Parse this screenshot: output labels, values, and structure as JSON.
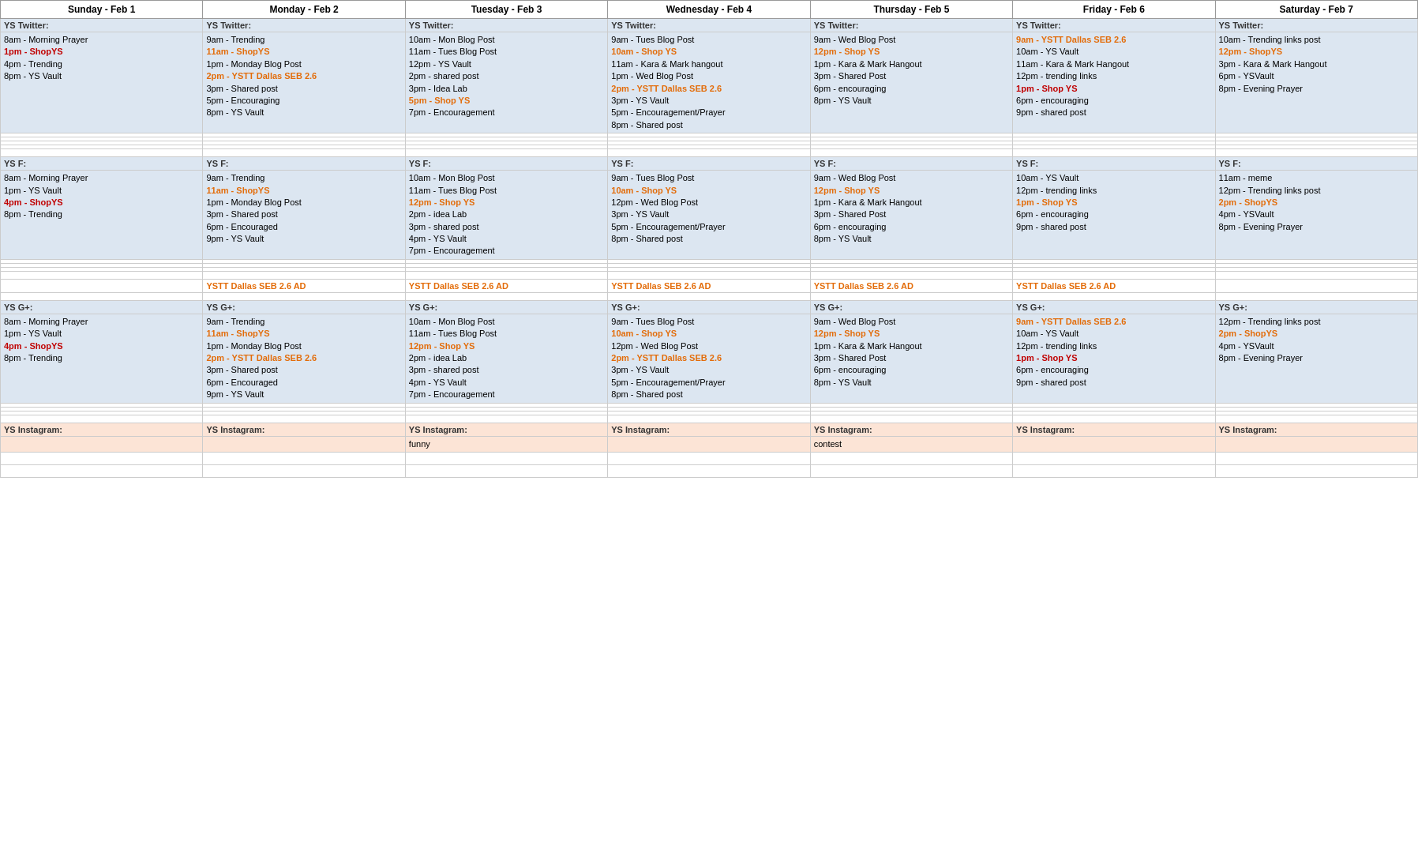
{
  "headers": [
    "Sunday - Feb 1",
    "Monday - Feb 2",
    "Tuesday - Feb 3",
    "Wednesday - Feb 4",
    "Thursday - Feb 5",
    "Friday - Feb 6",
    "Saturday - Feb 7"
  ],
  "twitter_section": {
    "label": "YS Twitter:",
    "bg": "bg-blue",
    "rows": [
      {
        "sun": [
          {
            "text": "8am - Morning Prayer",
            "color": "black"
          },
          {
            "text": "1pm - ShopYS",
            "color": "red"
          },
          {
            "text": "4pm - Trending",
            "color": "black"
          },
          {
            "text": "8pm - YS Vault",
            "color": "black"
          }
        ],
        "mon": [
          {
            "text": "9am - Trending",
            "color": "black"
          },
          {
            "text": "11am - ShopYS",
            "color": "orange"
          },
          {
            "text": "1pm - Monday Blog Post",
            "color": "black"
          },
          {
            "text": "2pm - YSTT Dallas SEB 2.6",
            "color": "orange"
          },
          {
            "text": "3pm - Shared post",
            "color": "black"
          },
          {
            "text": "5pm - Encouraging",
            "color": "black"
          },
          {
            "text": "8pm - YS Vault",
            "color": "black"
          }
        ],
        "tue": [
          {
            "text": "10am - Mon Blog Post",
            "color": "black"
          },
          {
            "text": "11am - Tues Blog Post",
            "color": "black"
          },
          {
            "text": "12pm - YS Vault",
            "color": "black"
          },
          {
            "text": "2pm - shared post",
            "color": "black"
          },
          {
            "text": "3pm - Idea Lab",
            "color": "black"
          },
          {
            "text": "5pm - Shop YS",
            "color": "orange"
          },
          {
            "text": "7pm - Encouragement",
            "color": "black"
          }
        ],
        "wed": [
          {
            "text": "9am - Tues Blog Post",
            "color": "black"
          },
          {
            "text": "10am - Shop YS",
            "color": "orange"
          },
          {
            "text": "11am - Kara & Mark hangout",
            "color": "black"
          },
          {
            "text": "1pm - Wed Blog Post",
            "color": "black"
          },
          {
            "text": "2pm - YSTT Dallas SEB 2.6",
            "color": "orange"
          },
          {
            "text": "3pm - YS Vault",
            "color": "black"
          },
          {
            "text": "5pm - Encouragement/Prayer",
            "color": "black"
          },
          {
            "text": "8pm - Shared post",
            "color": "black"
          }
        ],
        "thu": [
          {
            "text": "9am - Wed Blog Post",
            "color": "black"
          },
          {
            "text": "12pm - Shop YS",
            "color": "orange"
          },
          {
            "text": "1pm - Kara & Mark Hangout",
            "color": "black"
          },
          {
            "text": "3pm - Shared Post",
            "color": "black"
          },
          {
            "text": "6pm - encouraging",
            "color": "black"
          },
          {
            "text": "8pm - YS Vault",
            "color": "black"
          }
        ],
        "fri": [
          {
            "text": "9am - YSTT Dallas SEB 2.6",
            "color": "orange"
          },
          {
            "text": "10am - YS Vault",
            "color": "black"
          },
          {
            "text": "11am - Kara & Mark Hangout",
            "color": "black"
          },
          {
            "text": "12pm - trending links",
            "color": "black"
          },
          {
            "text": "1pm - Shop YS",
            "color": "red"
          },
          {
            "text": "6pm - encouraging",
            "color": "black"
          },
          {
            "text": "9pm - shared post",
            "color": "black"
          }
        ],
        "sat": [
          {
            "text": "10am - Trending links post",
            "color": "black"
          },
          {
            "text": "12pm - ShopYS",
            "color": "orange"
          },
          {
            "text": "3pm - Kara & Mark Hangout",
            "color": "black"
          },
          {
            "text": "6pm - YSVault",
            "color": "black"
          },
          {
            "text": "8pm - Evening Prayer",
            "color": "black"
          }
        ]
      }
    ]
  },
  "facebook_section": {
    "label": "YS F:",
    "bg": "bg-blue",
    "rows": [
      {
        "sun": [
          {
            "text": "8am - Morning Prayer",
            "color": "black"
          },
          {
            "text": "1pm - YS Vault",
            "color": "black"
          },
          {
            "text": "4pm - ShopYS",
            "color": "red"
          },
          {
            "text": "8pm - Trending",
            "color": "black"
          }
        ],
        "mon": [
          {
            "text": "9am - Trending",
            "color": "black"
          },
          {
            "text": "11am - ShopYS",
            "color": "orange"
          },
          {
            "text": "1pm - Monday Blog Post",
            "color": "black"
          },
          {
            "text": "3pm - Shared post",
            "color": "black"
          },
          {
            "text": "6pm - Encouraged",
            "color": "black"
          },
          {
            "text": "9pm - YS Vault",
            "color": "black"
          }
        ],
        "tue": [
          {
            "text": "10am - Mon Blog Post",
            "color": "black"
          },
          {
            "text": "11am - Tues Blog Post",
            "color": "black"
          },
          {
            "text": "12pm - Shop YS",
            "color": "orange"
          },
          {
            "text": "2pm - idea Lab",
            "color": "black"
          },
          {
            "text": "3pm - shared post",
            "color": "black"
          },
          {
            "text": "4pm - YS Vault",
            "color": "black"
          },
          {
            "text": "7pm - Encouragement",
            "color": "black"
          }
        ],
        "wed": [
          {
            "text": "9am - Tues Blog Post",
            "color": "black"
          },
          {
            "text": "10am - Shop YS",
            "color": "orange"
          },
          {
            "text": "12pm - Wed Blog Post",
            "color": "black"
          },
          {
            "text": "3pm - YS Vault",
            "color": "black"
          },
          {
            "text": "5pm - Encouragement/Prayer",
            "color": "black"
          },
          {
            "text": "8pm - Shared post",
            "color": "black"
          }
        ],
        "thu": [
          {
            "text": "9am - Wed Blog Post",
            "color": "black"
          },
          {
            "text": "12pm - Shop YS",
            "color": "orange"
          },
          {
            "text": "1pm - Kara & Mark Hangout",
            "color": "black"
          },
          {
            "text": "3pm - Shared Post",
            "color": "black"
          },
          {
            "text": "6pm - encouraging",
            "color": "black"
          },
          {
            "text": "8pm - YS Vault",
            "color": "black"
          }
        ],
        "fri": [
          {
            "text": "10am - YS Vault",
            "color": "black"
          },
          {
            "text": "12pm - trending links",
            "color": "black"
          },
          {
            "text": "1pm - Shop YS",
            "color": "orange"
          },
          {
            "text": "6pm - encouraging",
            "color": "black"
          },
          {
            "text": "9pm - shared post",
            "color": "black"
          }
        ],
        "sat": [
          {
            "text": "11am - meme",
            "color": "black"
          },
          {
            "text": "12pm - Trending links post",
            "color": "black"
          },
          {
            "text": "2pm - ShopYS",
            "color": "orange"
          },
          {
            "text": "4pm - YSVault",
            "color": "black"
          },
          {
            "text": "8pm - Evening Prayer",
            "color": "black"
          }
        ]
      }
    ]
  },
  "ystt_row": {
    "sun": "",
    "mon": "YSTT Dallas SEB 2.6 AD",
    "tue": "YSTT Dallas SEB 2.6 AD",
    "wed": "YSTT Dallas SEB 2.6 AD",
    "thu": "YSTT Dallas SEB 2.6 AD",
    "fri": "YSTT Dallas SEB 2.6 AD",
    "sat": ""
  },
  "gplus_section": {
    "label": "YS G+:",
    "bg": "bg-blue",
    "rows": [
      {
        "sun": [
          {
            "text": "8am - Morning Prayer",
            "color": "black"
          },
          {
            "text": "1pm - YS Vault",
            "color": "black"
          },
          {
            "text": "4pm - ShopYS",
            "color": "red"
          },
          {
            "text": "8pm - Trending",
            "color": "black"
          }
        ],
        "mon": [
          {
            "text": "9am - Trending",
            "color": "black"
          },
          {
            "text": "11am - ShopYS",
            "color": "orange"
          },
          {
            "text": "1pm - Monday Blog Post",
            "color": "black"
          },
          {
            "text": "2pm - YSTT Dallas SEB 2.6",
            "color": "orange"
          },
          {
            "text": "3pm - Shared post",
            "color": "black"
          },
          {
            "text": "6pm - Encouraged",
            "color": "black"
          },
          {
            "text": "9pm - YS Vault",
            "color": "black"
          }
        ],
        "tue": [
          {
            "text": "10am - Mon Blog Post",
            "color": "black"
          },
          {
            "text": "11am - Tues Blog Post",
            "color": "black"
          },
          {
            "text": "12pm - Shop YS",
            "color": "orange"
          },
          {
            "text": "2pm - idea Lab",
            "color": "black"
          },
          {
            "text": "3pm - shared post",
            "color": "black"
          },
          {
            "text": "4pm - YS Vault",
            "color": "black"
          },
          {
            "text": "7pm - Encouragement",
            "color": "black"
          }
        ],
        "wed": [
          {
            "text": "9am - Tues Blog Post",
            "color": "black"
          },
          {
            "text": "10am - Shop YS",
            "color": "orange"
          },
          {
            "text": "12pm - Wed Blog Post",
            "color": "black"
          },
          {
            "text": "2pm - YSTT Dallas SEB 2.6",
            "color": "orange"
          },
          {
            "text": "3pm - YS Vault",
            "color": "black"
          },
          {
            "text": "5pm - Encouragement/Prayer",
            "color": "black"
          },
          {
            "text": "8pm - Shared post",
            "color": "black"
          }
        ],
        "thu": [
          {
            "text": "9am - Wed Blog Post",
            "color": "black"
          },
          {
            "text": "12pm - Shop YS",
            "color": "orange"
          },
          {
            "text": "1pm - Kara & Mark Hangout",
            "color": "black"
          },
          {
            "text": "3pm - Shared Post",
            "color": "black"
          },
          {
            "text": "6pm - encouraging",
            "color": "black"
          },
          {
            "text": "8pm - YS Vault",
            "color": "black"
          }
        ],
        "fri": [
          {
            "text": "9am - YSTT Dallas SEB 2.6",
            "color": "orange"
          },
          {
            "text": "10am - YS Vault",
            "color": "black"
          },
          {
            "text": "12pm - trending links",
            "color": "black"
          },
          {
            "text": "1pm - Shop YS",
            "color": "red"
          },
          {
            "text": "6pm - encouraging",
            "color": "black"
          },
          {
            "text": "9pm - shared post",
            "color": "black"
          }
        ],
        "sat": [
          {
            "text": "12pm - Trending links post",
            "color": "black"
          },
          {
            "text": "2pm - ShopYS",
            "color": "orange"
          },
          {
            "text": "4pm - YSVault",
            "color": "black"
          },
          {
            "text": "8pm - Evening Prayer",
            "color": "black"
          }
        ]
      }
    ]
  },
  "instagram_section": {
    "label": "YS Instagram:",
    "rows": [
      {
        "sun": [],
        "mon": [],
        "tue": [
          {
            "text": "funny",
            "color": "black"
          }
        ],
        "wed": [],
        "thu": [
          {
            "text": "contest",
            "color": "black"
          }
        ],
        "fri": [],
        "sat": []
      }
    ]
  }
}
